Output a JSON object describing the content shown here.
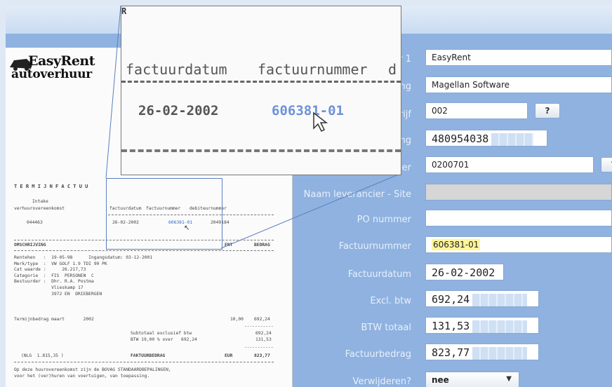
{
  "form": {
    "fields": [
      {
        "label": "r 1",
        "value": "EasyRent"
      },
      {
        "label": "ing",
        "value": "Magellan Software"
      },
      {
        "label": "rijf",
        "value": "002"
      },
      {
        "label": "ing",
        "value": "480954038"
      },
      {
        "label": "ner",
        "value": "0200701"
      },
      {
        "label": "Naam leverancier - Site",
        "value": ""
      },
      {
        "label": "PO nummer",
        "value": ""
      },
      {
        "label": "Factuurnummer",
        "value": "606381-01"
      },
      {
        "label": "Factuurdatum",
        "value": "26-02-2002"
      },
      {
        "label": "Excl. btw",
        "value": "692,24"
      },
      {
        "label": "BTW totaal",
        "value": "131,53"
      },
      {
        "label": "Factuurbedrag",
        "value": "823,77"
      },
      {
        "label": "Verwijderen?",
        "value": "nee"
      }
    ],
    "lookup_label": "?",
    "highlight_color": "#fff59a"
  },
  "document": {
    "logo_line1": "EasyRent",
    "logo_line2": "autoverhuur",
    "title": "T E R M I J N F A C T U U",
    "intake_label": "Intake",
    "agreement_label": "verhuurovereenkomst",
    "agreement_no": "044463",
    "col_date": "factuurdatum",
    "col_invoice": "factuurnummer",
    "col_debtor": "debiteurnummer",
    "date": "26-02-2002",
    "invoice_no": "606381-01",
    "debtor_no": "2049184",
    "desc_header": "OMSCHRIJVING",
    "amount_header": "BEDRAG",
    "amount_header_partial": "ENT",
    "details": "Rentehen   :  19-05-98      Ingangsdatum: 03-12-2001\nMerk/type  :  VW GOLF 1.9 TDI 90 PK\nCat waarde :      26.217,73\nCategorie  :  FIS  PERSONEN  C\nBestuurder :  Dhr. R.A. Postma\n              Vlieskamp 17\n              3972 EN  DRIEBERGEN",
    "term_line": "Termijnbedrag maart       2002",
    "term_qty": "10,00",
    "term_amount": "692,24",
    "subtotal_label": "Subtotaal exclusief btw",
    "subtotal_value": "692,24",
    "vat_label": "BTW 19,00 % over   692,24",
    "vat_value": "131,53",
    "nlg": "(NLG  1.815,35 )",
    "total_label": "FAKTUURBEDRAG",
    "currency": "EUR",
    "total_value": "823,77",
    "footer": "Op deze huurovereenkomst zijn de BOVAG STANDAARDBEPALINGEN,\nvoor het (ver)huren van voertuigen, van toepassing."
  },
  "zoom": {
    "col1": "factuurdatum",
    "col2": "factuurnummer",
    "col3": "d",
    "date": "26-02-2002",
    "invoice": "606381-01",
    "corner_mark": "R"
  }
}
